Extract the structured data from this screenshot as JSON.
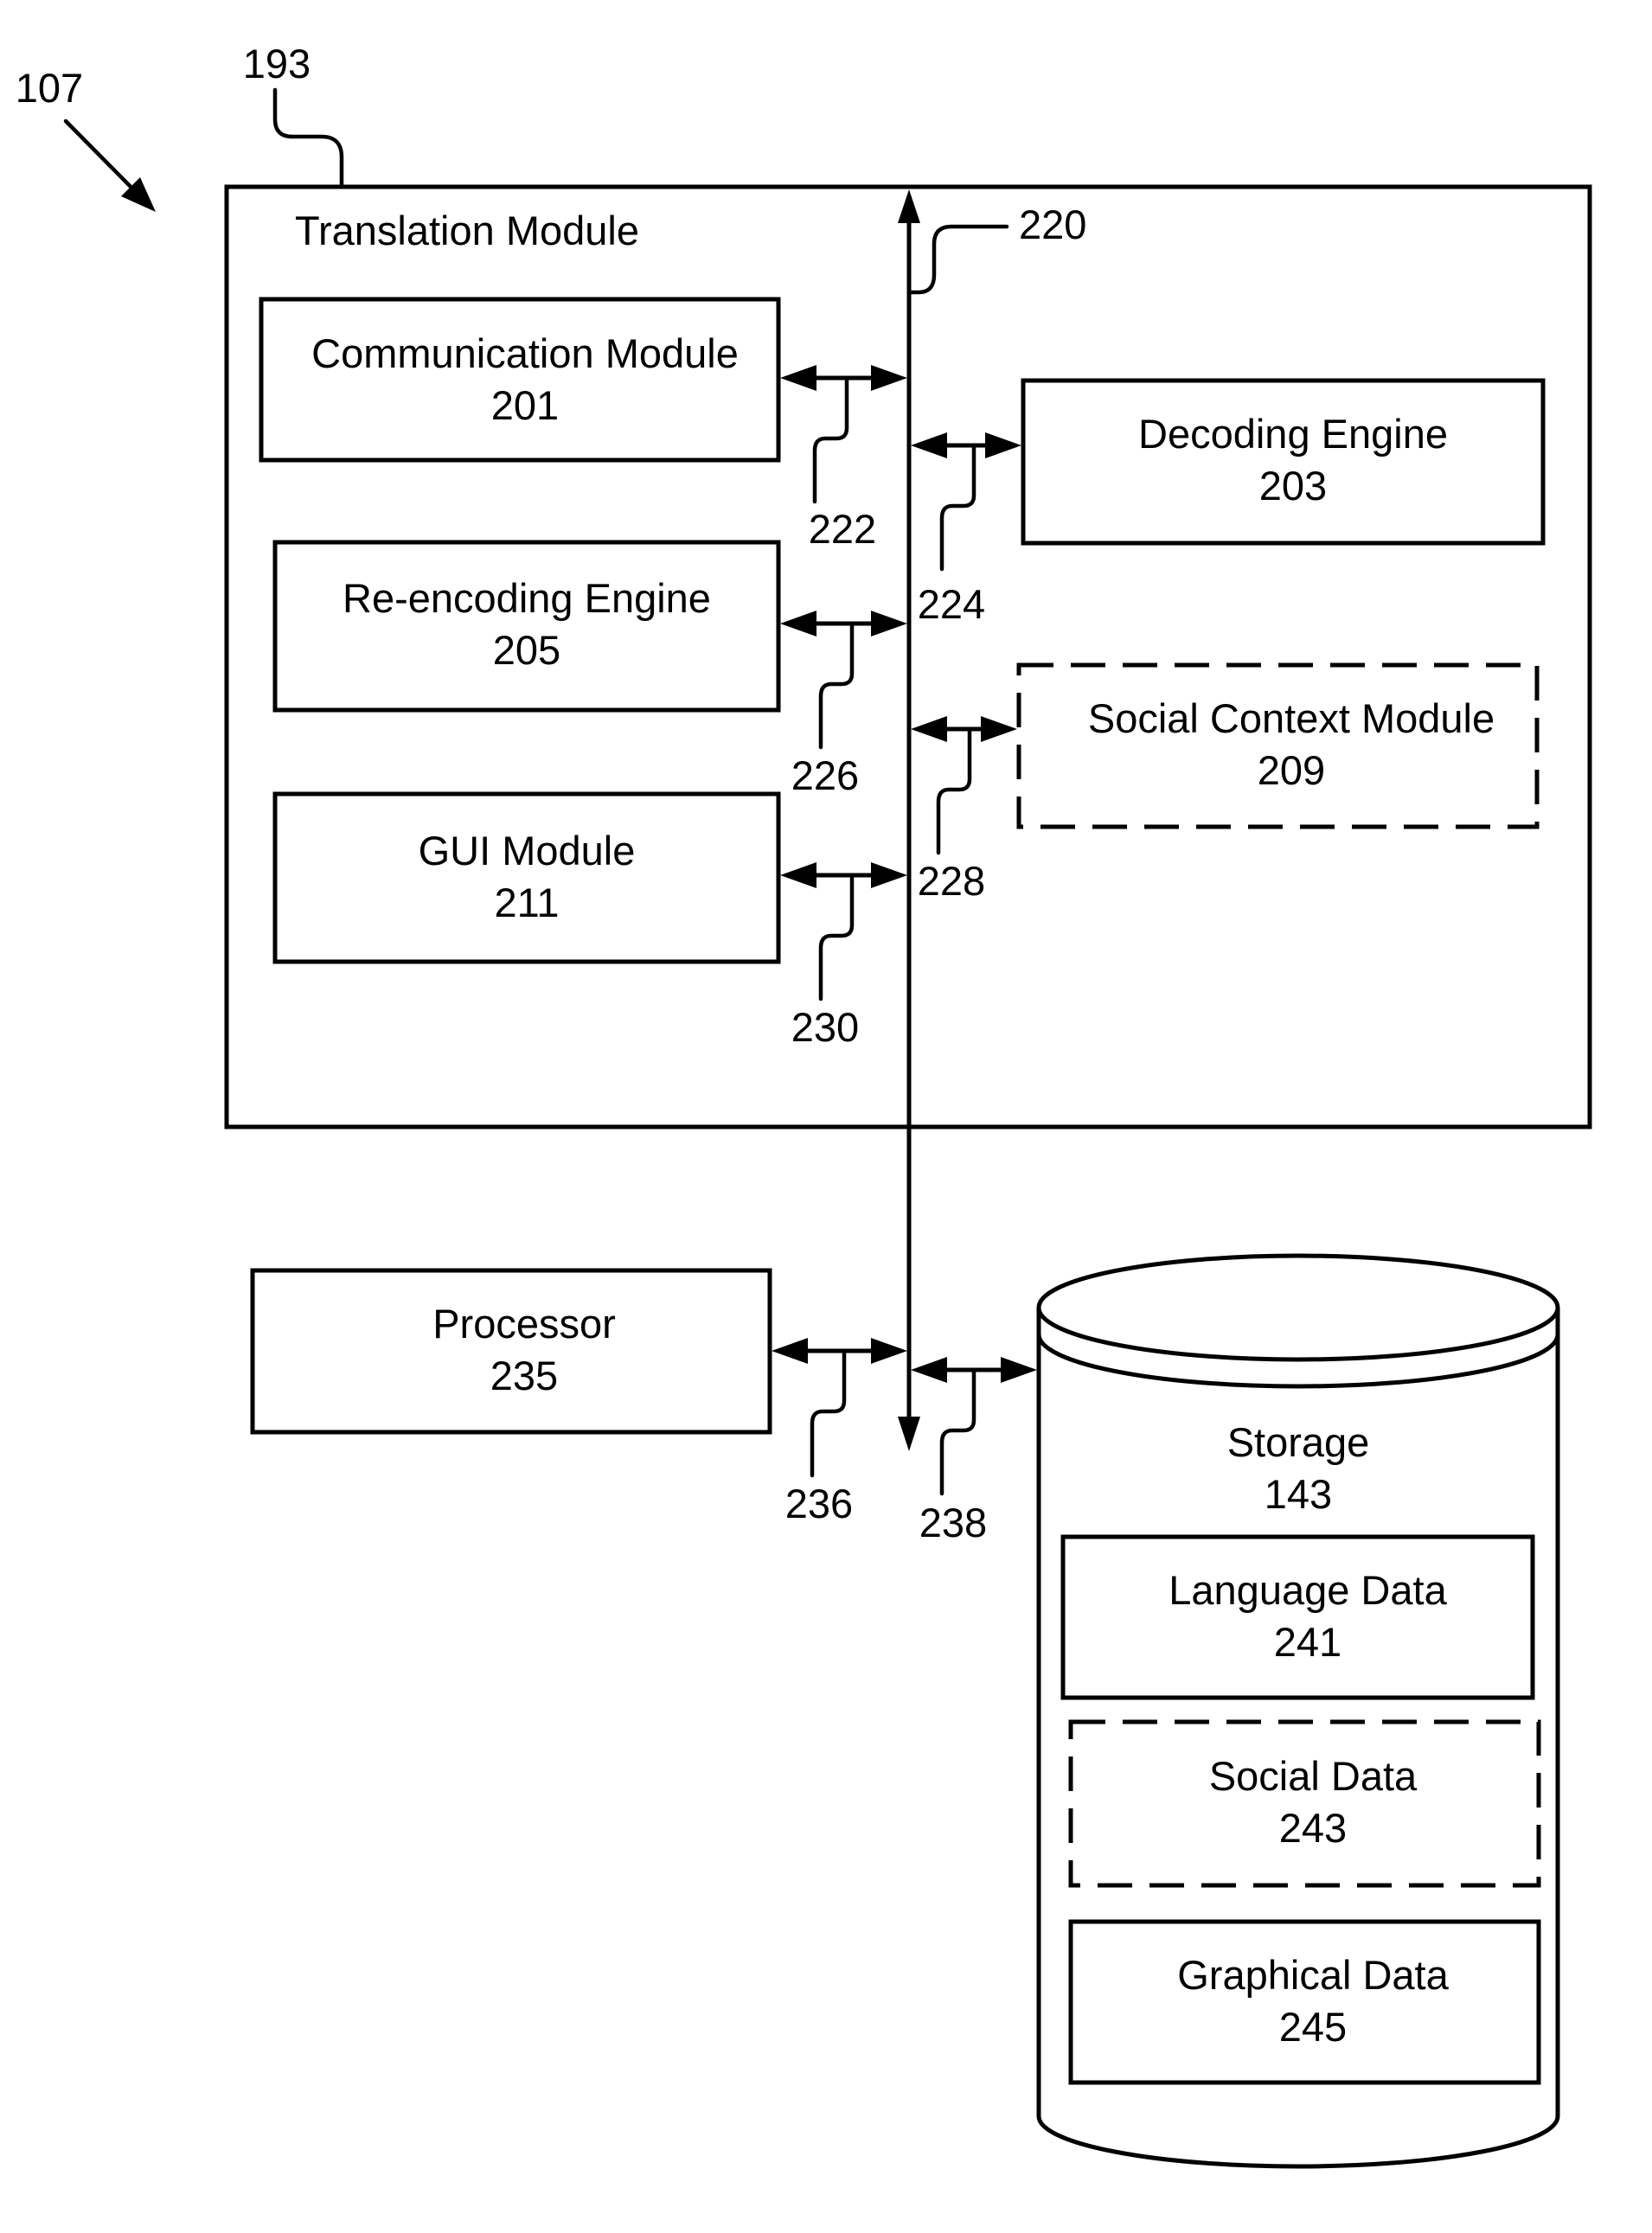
{
  "figure": {
    "ref_system": "107",
    "ref_translation_module": "193",
    "ref_bus": "220"
  },
  "translation_module": {
    "title": "Translation Module",
    "nodes": [
      {
        "id": "communication",
        "label": "Communication Module",
        "number": "201",
        "style": "solid",
        "connector_ref": "222"
      },
      {
        "id": "decoding",
        "label": "Decoding Engine",
        "number": "203",
        "style": "solid",
        "connector_ref": "224"
      },
      {
        "id": "reencoding",
        "label": "Re-encoding Engine",
        "number": "205",
        "style": "solid",
        "connector_ref": "226"
      },
      {
        "id": "social_context",
        "label": "Social Context Module",
        "number": "209",
        "style": "dashed",
        "connector_ref": "228"
      },
      {
        "id": "gui",
        "label": "GUI Module",
        "number": "211",
        "style": "solid",
        "connector_ref": "230"
      }
    ]
  },
  "processor": {
    "label": "Processor",
    "number": "235",
    "connector_ref": "236"
  },
  "storage": {
    "label": "Storage",
    "number": "143",
    "connector_ref": "238",
    "items": [
      {
        "id": "language_data",
        "label": "Language Data",
        "number": "241",
        "style": "solid"
      },
      {
        "id": "social_data",
        "label": "Social Data",
        "number": "243",
        "style": "dashed"
      },
      {
        "id": "graphical_data",
        "label": "Graphical Data",
        "number": "245",
        "style": "solid"
      }
    ]
  }
}
